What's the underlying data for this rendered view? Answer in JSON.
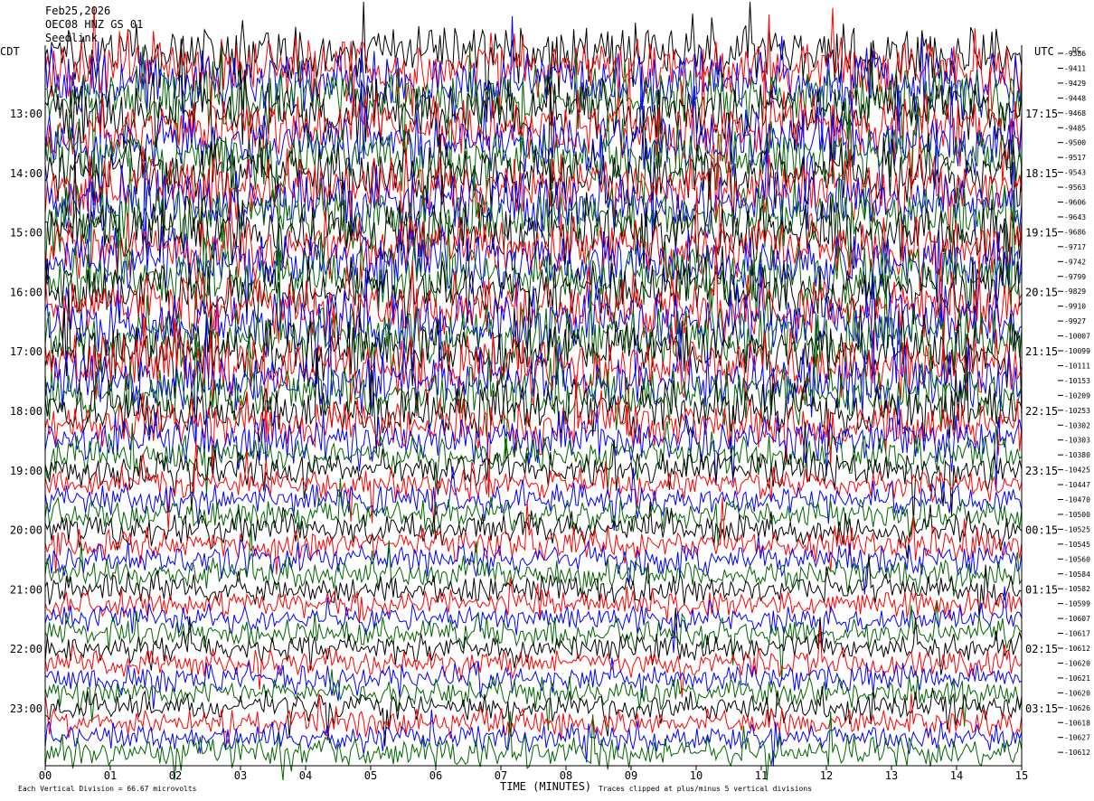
{
  "header": {
    "date": "Feb25,2026",
    "station": "OEC08 HNZ GS 01",
    "subtitle": "Seedlink"
  },
  "left_axis_label": "CDT",
  "right_axis_label": "UTC",
  "dc_label": "DC",
  "colors": {
    "trace_cycle": [
      "#000000",
      "#ff0000",
      "#0000ff",
      "#006400"
    ],
    "background": "#ffffff",
    "axis": "#000000"
  },
  "footer": {
    "scale_note": "Each Vertical Division =   66.67 microvolts",
    "xlabel": "TIME (MINUTES)",
    "clip_note": "Traces clipped at plus/minus 5 vertical divisions"
  },
  "chart_data": {
    "type": "line",
    "title": "Feb25,2026",
    "xlabel": "TIME (MINUTES)",
    "xlim": [
      0,
      15
    ],
    "x_ticks": [
      "00",
      "01",
      "02",
      "03",
      "04",
      "05",
      "06",
      "07",
      "08",
      "09",
      "10",
      "11",
      "12",
      "13",
      "14",
      "15"
    ],
    "rows_per_hour": 4,
    "row_count": 48,
    "left_hour_labels": [
      "13:00",
      "14:00",
      "15:00",
      "16:00",
      "17:00",
      "18:00",
      "19:00",
      "20:00",
      "21:00",
      "22:00",
      "23:00"
    ],
    "right_hour_labels": [
      "17:15",
      "18:15",
      "19:15",
      "20:15",
      "21:15",
      "22:15",
      "23:15",
      "00:15",
      "01:15",
      "02:15",
      "03:15"
    ],
    "dc_offsets": [
      "-9386",
      "-9411",
      "-9429",
      "-9448",
      "-9468",
      "-9485",
      "-9500",
      "-9517",
      "-9543",
      "-9563",
      "-9606",
      "-9643",
      "-9686",
      "-9717",
      "-9742",
      "-9799",
      "-9829",
      "-9910",
      "-9927",
      "-10007",
      "-10099",
      "-10111",
      "-10153",
      "-10209",
      "-10253",
      "-10302",
      "-10303",
      "-10380",
      "-10425",
      "-10447",
      "-10470",
      "-10500",
      "-10525",
      "-10545",
      "-10560",
      "-10584",
      "-10582",
      "-10599",
      "-10607",
      "-10617",
      "-10612",
      "-10620",
      "-10621",
      "-10620",
      "-10626",
      "-10618",
      "-10627",
      "-10612"
    ],
    "amplitude_profile": [
      0.9,
      1.0,
      1.0,
      1.0,
      1.0,
      1.0,
      1.0,
      1.0,
      1.0,
      1.0,
      1.0,
      1.0,
      1.0,
      1.0,
      1.0,
      1.0,
      1.0,
      1.0,
      1.0,
      1.0,
      1.0,
      1.0,
      0.95,
      0.9,
      0.85,
      0.8,
      0.7,
      0.6,
      0.55,
      0.5,
      0.5,
      0.5,
      0.5,
      0.5,
      0.5,
      0.45,
      0.45,
      0.45,
      0.45,
      0.45,
      0.45,
      0.45,
      0.45,
      0.45,
      0.45,
      0.45,
      0.45,
      0.5
    ]
  }
}
